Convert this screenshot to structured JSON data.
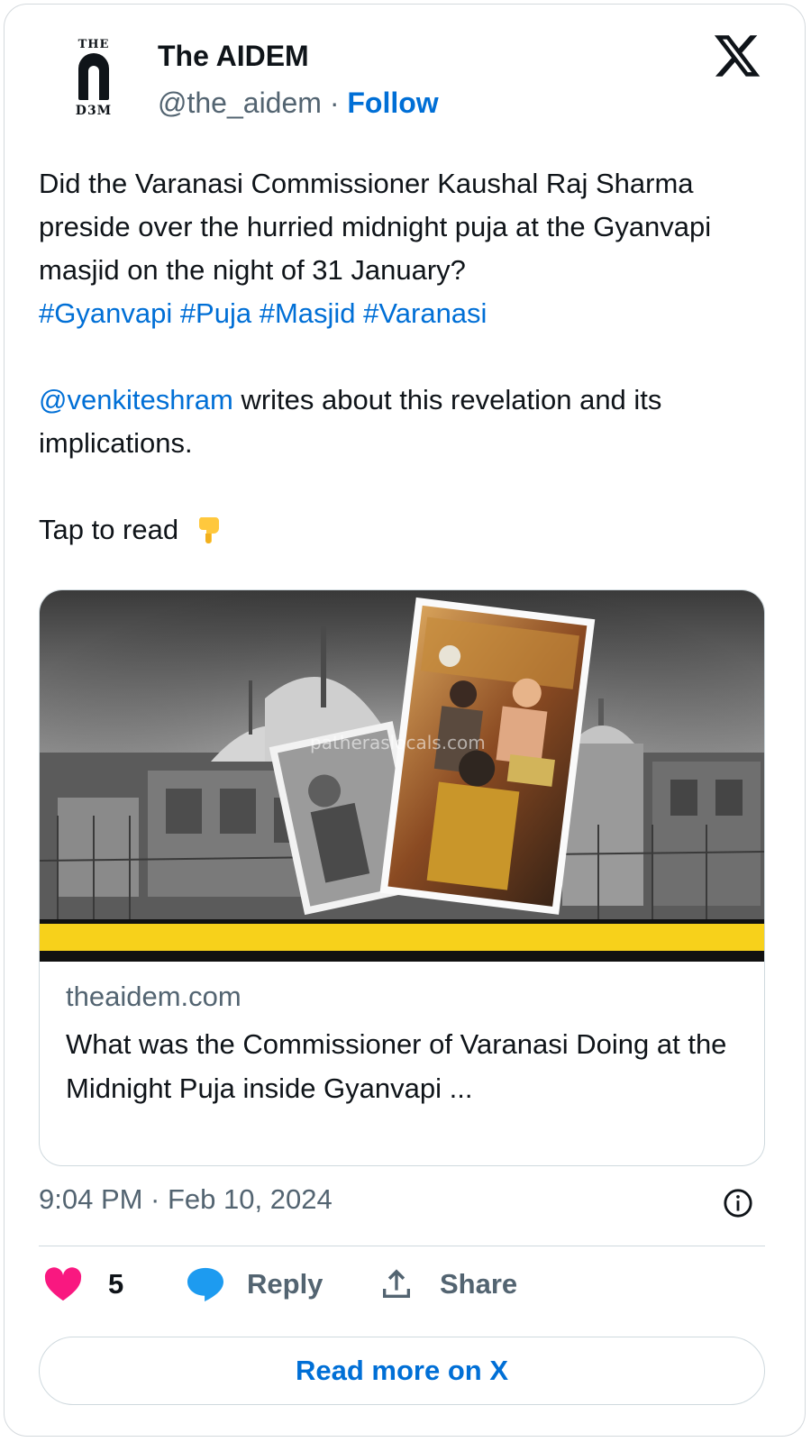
{
  "account": {
    "name": "The AIDEM",
    "handle": "@the_aidem",
    "separator": "·",
    "follow_label": "Follow",
    "avatar_top": "THE",
    "avatar_bottom": "D3M"
  },
  "tweet": {
    "line1": "Did the Varanasi Commissioner Kaushal Raj Sharma preside over the hurried midnight puja at the Gyanvapi masjid on the night of 31 January?",
    "hashtags": "#Gyanvapi #Puja #Masjid #Varanasi",
    "mention": "@venkiteshram",
    "line2_rest": " writes about this revelation and its implications.",
    "line3": "Tap to read"
  },
  "link_card": {
    "domain": "theaidem.com",
    "title": "What was the Commissioner of Varanasi Doing at the Midnight Puja inside Gyanvapi ...",
    "watermark": "patheraslocals.com"
  },
  "meta": {
    "timestamp": "9:04 PM · Feb 10, 2024"
  },
  "actions": {
    "like_count": "5",
    "reply_label": "Reply",
    "share_label": "Share"
  },
  "footer": {
    "read_more_label": "Read more on X"
  },
  "colors": {
    "link": "#006fd6",
    "like": "#f91880",
    "reply": "#1d9bf0",
    "muted": "#536471",
    "banner_yellow": "#f7d11b"
  },
  "icons": [
    "x-logo-icon",
    "pointing-down-emoji-icon",
    "info-icon",
    "heart-icon",
    "reply-bubble-icon",
    "share-icon"
  ]
}
